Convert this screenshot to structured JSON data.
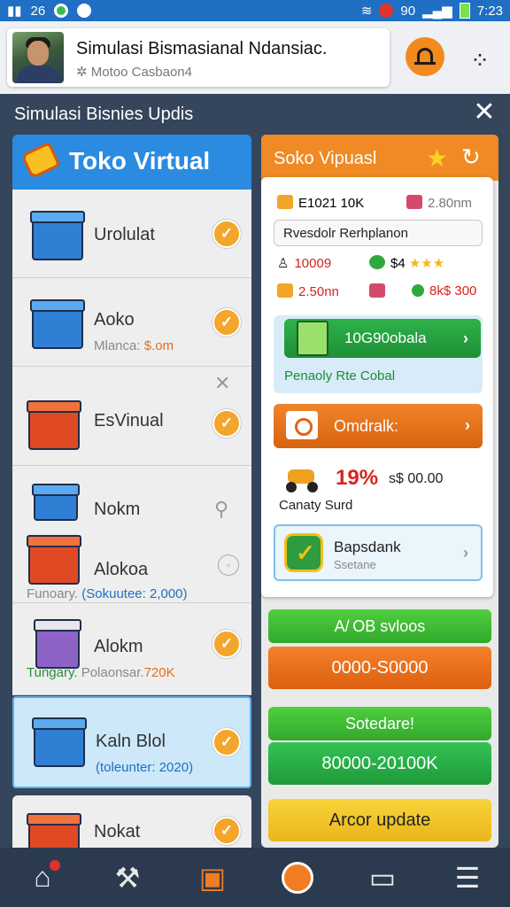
{
  "status_bar": {
    "left_text": "26",
    "right_text": "90",
    "time": "7:23"
  },
  "header": {
    "title": "Simulasi Bismasianal Ndansiac.",
    "subtitle": "Motoo Casbaon4"
  },
  "panel": {
    "title": "Simulasi Bisnies Updis"
  },
  "store": {
    "title": "Toko Virtual",
    "items": [
      {
        "name": "Urolulat",
        "sub": ""
      },
      {
        "name": "Aoko",
        "sub_label": "Mlanca: ",
        "sub_value": "$.om"
      },
      {
        "name": "EsVinual",
        "sub": ""
      },
      {
        "name": "Nokm",
        "sub": ""
      },
      {
        "name": "Alokoa",
        "sub_prefix": "Funoary.",
        "sub_value": "(Sokuutee: 2,000)"
      },
      {
        "name": "Alokm",
        "sub_prefix": "Tungary.",
        "sub_label": "Polaonsar.",
        "sub_value": "720K"
      },
      {
        "name": "Kaln Blol",
        "sub_value": "(toleunter: 2020)"
      },
      {
        "name": "Nokat",
        "sub": ""
      }
    ]
  },
  "panel_right": {
    "title": "Soko Vipuasl",
    "stats": {
      "s1": "E1021 10K",
      "s2": "2.80nm",
      "search": "Rvesdolr Rerhplanon",
      "s3": "10009",
      "s4": "$4",
      "s5": "2.50nn",
      "s6": "8k$ 300"
    },
    "boost": {
      "button": "10G90obala",
      "caption": "Penaoly Rte Cobal"
    },
    "order_button": "Omdralk:",
    "promo": {
      "percent": "19%",
      "price": "s$ 00.00",
      "caption": "Canaty Surd"
    },
    "badge": {
      "title": "Bapsdank",
      "subtitle": "Ssetane"
    },
    "pills": [
      "A/ OB svloos",
      "0000-S0000",
      "Sotedare!",
      "80000-20100K",
      "Arcor update"
    ]
  },
  "colors": {
    "accent_blue": "#2a8be0",
    "accent_orange": "#f08a24",
    "accent_green": "#2eb24a"
  }
}
